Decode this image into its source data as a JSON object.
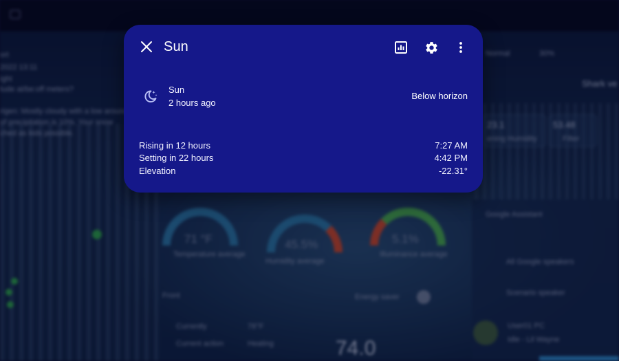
{
  "dialog": {
    "title": "Sun",
    "close_icon": "close-icon",
    "history_icon": "chart-icon",
    "settings_icon": "gear-icon",
    "menu_icon": "more-vertical-icon",
    "state": {
      "icon": "moon-star-icon",
      "name": "Sun",
      "last_changed": "2 hours ago",
      "value": "Below horizon"
    },
    "attributes": [
      {
        "label": "Rising in 12 hours",
        "value": "7:27 AM"
      },
      {
        "label": "Setting in 22 hours",
        "value": "4:42 PM"
      },
      {
        "label": "Elevation",
        "value": "-22.31°"
      }
    ],
    "colors": {
      "background": "#15188a",
      "icon": "#b9bff5",
      "text": "#ffffff"
    }
  },
  "background": {
    "top_left_lines": [
      "ort",
      "2022 13:11",
      "ight",
      "tude at/be:off meters?",
      "rigen: Mostly cloudy with a low around",
      "of precipitation is 10%. Your snow",
      "ched as kids possible."
    ],
    "weather_cards": [
      {
        "value": "23.1",
        "label": "ening Humidity"
      },
      {
        "value": "53.48",
        "label": "Filter"
      }
    ],
    "header_right": [
      "Normal",
      "30%"
    ],
    "top_right_title": "Shark ve",
    "gauges": [
      {
        "value": "71 °F",
        "label": "Temperature average"
      },
      {
        "value": "45.5%",
        "label": "Humidity average"
      },
      {
        "value": "5.1%",
        "label": "Illuminance average"
      }
    ],
    "energy_label": "Energy saver",
    "front_label": "Front",
    "thermostat": {
      "rows": [
        {
          "label": "Currently",
          "value": "78°F"
        },
        {
          "label": "Current action",
          "value": "Heating"
        }
      ],
      "target": "74.0"
    },
    "side_items": [
      "Google Assistant",
      "All Google speakers",
      "Scenario speaker",
      "User01 PC",
      "Idle - Lil Wayne"
    ]
  }
}
